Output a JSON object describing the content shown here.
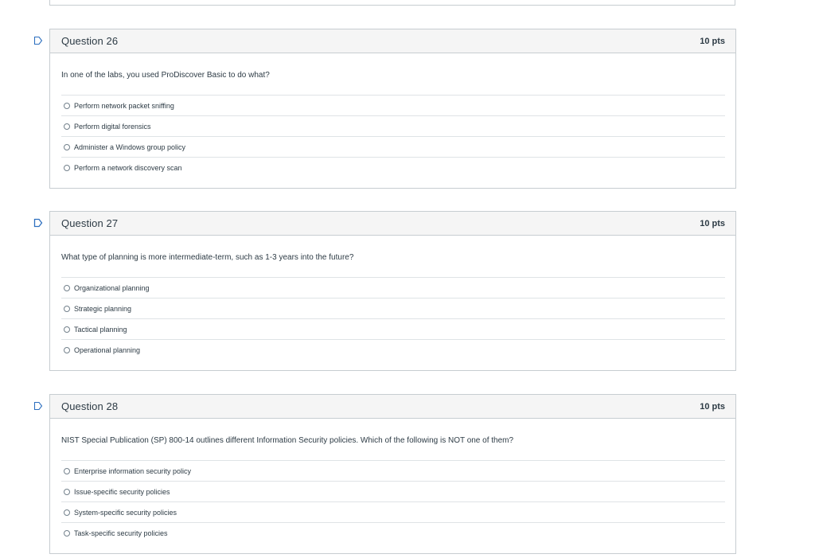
{
  "questions": [
    {
      "title": "Question 26",
      "points": "10 pts",
      "text": "In one of the labs, you used ProDiscover Basic to do what?",
      "answers": [
        "Perform network packet sniffing",
        "Perform digital forensics",
        "Administer a Windows group policy",
        "Perform a network discovery scan"
      ]
    },
    {
      "title": "Question 27",
      "points": "10 pts",
      "text": "What type of planning is more intermediate-term, such as 1-3 years into the future?",
      "answers": [
        "Organizational planning",
        "Strategic planning",
        "Tactical planning",
        "Operational planning"
      ]
    },
    {
      "title": "Question 28",
      "points": "10 pts",
      "text": "NIST Special Publication (SP) 800-14 outlines different Information Security policies. Which of the following is NOT one of them?",
      "answers": [
        "Enterprise information security policy",
        "Issue-specific security policies",
        "System-specific security policies",
        "Task-specific security policies"
      ]
    }
  ],
  "icons": {
    "flag": "bookmark-flag-icon",
    "radio": "radio-button"
  },
  "colors": {
    "header_bg": "#f5f5f5",
    "border": "#c7cdd1",
    "flag": "#2d6fbf",
    "text": "#2d3b45"
  }
}
